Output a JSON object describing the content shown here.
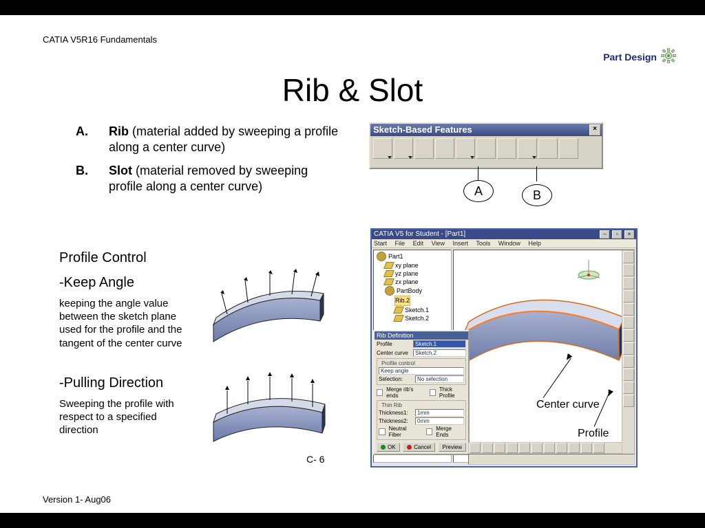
{
  "header": {
    "text": "CATIA V5R16 Fundamentals"
  },
  "footer": {
    "text": "Version 1- Aug06"
  },
  "page_number": "C- 6",
  "badge": {
    "text": "Part Design"
  },
  "title": "Rib & Slot",
  "definitions": {
    "A": {
      "letter": "A.",
      "term": "Rib",
      "desc": " (material added by sweeping a profile along a center curve)"
    },
    "B": {
      "letter": "B.",
      "term": "Slot",
      "desc": " (material removed by sweeping profile along a center curve)"
    }
  },
  "left": {
    "h1": "Profile Control",
    "h2a": "-Keep Angle",
    "p2a": "keeping the angle value between the sketch plane used for the profile and the tangent of the center curve",
    "h2b": "-Pulling Direction",
    "p2b": "Sweeping the profile with respect to a specified direction"
  },
  "toolbar": {
    "title": "Sketch-Based Features",
    "callout_a": "A",
    "callout_b": "B"
  },
  "catia": {
    "title": "CATIA V5 for Student - [Part1]",
    "menu": [
      "Start",
      "File",
      "Edit",
      "View",
      "Insert",
      "Tools",
      "Window",
      "Help"
    ],
    "tree": {
      "root": "Part1",
      "planes": [
        "xy plane",
        "yz plane",
        "zx plane"
      ],
      "body": "PartBody",
      "feature": "Rib.2",
      "sketches": [
        "Sketch.1",
        "Sketch.2"
      ]
    }
  },
  "dialog": {
    "title": "Rib Definition",
    "profile_label": "Profile",
    "profile_value": "Sketch.1",
    "curve_label": "Center curve",
    "curve_value": "Sketch.2",
    "pc_group": "Profile control",
    "pc_value": "Keep angle",
    "sel_label": "Selection:",
    "sel_value": "No selection",
    "merge_ends": "Merge rib's ends",
    "thick_profile": "Thick Profile",
    "thin_group": "Thin Rib",
    "t1_label": "Thickness1:",
    "t1_value": "1mm",
    "t2_label": "Thickness2:",
    "t2_value": "0mm",
    "neutral": "Neutral Fiber",
    "merge2": "Merge Ends",
    "ok": "OK",
    "cancel": "Cancel",
    "preview": "Preview"
  },
  "annotations": {
    "center": "Center curve",
    "profile": "Profile"
  }
}
